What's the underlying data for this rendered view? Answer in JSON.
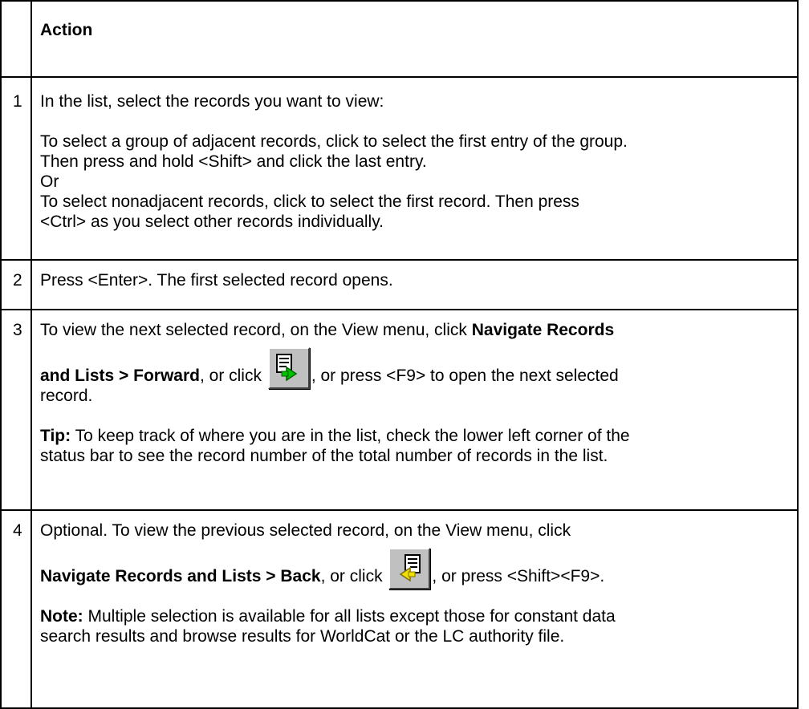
{
  "header": {
    "num": "",
    "action": "Action"
  },
  "steps": [
    {
      "num": "1",
      "lines": [
        "In the list, select the records you want to view:",
        "To select a group of adjacent records, click to select the first entry of the group.",
        "Then press and hold <Shift> and click the last entry.",
        "Or",
        "To select nonadjacent records, click to select the first record. Then press",
        "<Ctrl> as you select other records individually."
      ]
    },
    {
      "num": "2",
      "text": "Press <Enter>. The first selected record opens."
    },
    {
      "num": "3",
      "line1_text": "To view the next selected record, on the View menu, click ",
      "line1_bold": "Navigate Records",
      "line2_bold": "and Lists > Forward",
      "line2_text_before_icon": ", or click ",
      "line2_text_after_icon": ", or press <F9> to open the next selected",
      "line3_text": "record.",
      "tip_label": "Tip:",
      "tip_text": " To keep track of where you are in the list, check the lower left corner of the",
      "tip_text_2": "status bar to see the record number of the total number of records in the list.",
      "icon": "forward-record-icon"
    },
    {
      "num": "4",
      "line1_text": "Optional. To view the previous selected record, on the View menu, click",
      "line2_bold": "Navigate Records and Lists > Back",
      "line2_text_before_icon": ", or click ",
      "line2_text_after_icon": ", or press <Shift><F9>.",
      "note_label": "Note:",
      "note_text": " Multiple selection is available for all lists except those for constant data",
      "note_text_2": "search results and browse results for WorldCat or the LC authority file.",
      "icon": "back-record-icon"
    }
  ]
}
